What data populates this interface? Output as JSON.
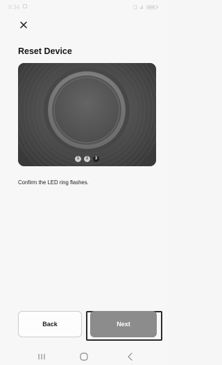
{
  "status_bar": {
    "time": "9:34"
  },
  "header": {
    "close_icon": "close-icon",
    "title": "Reset Device"
  },
  "hero": {
    "illustration": "led-ring-device",
    "steps": [
      "1",
      "2",
      "3"
    ],
    "active_step": 3
  },
  "content": {
    "instruction": "Confirm the LED ring flashes."
  },
  "footer": {
    "back_label": "Back",
    "next_label": "Next"
  },
  "navbar": {
    "icons": [
      "recent-apps-icon",
      "home-icon",
      "back-nav-icon"
    ]
  },
  "colors": {
    "background": "#f7f7f7",
    "primary_button": "#8c8c8c",
    "title_text": "#161616"
  }
}
